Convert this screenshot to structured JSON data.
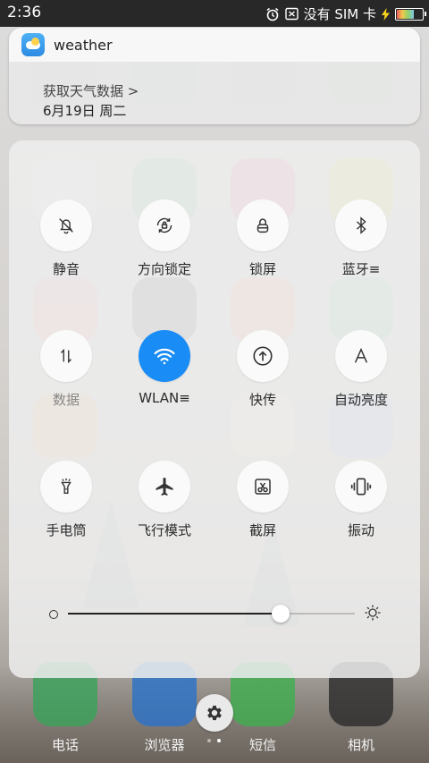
{
  "status_bar": {
    "time": "2:36",
    "carrier": "没有 SIM 卡",
    "battery_level": 0.7,
    "icons": [
      "alarm-icon",
      "sim-error-icon",
      "charging-icon",
      "battery-icon"
    ]
  },
  "notification": {
    "app_name": "weather",
    "line1": "获取天气数据 >",
    "line2": "6月19日 周二"
  },
  "quick_settings": {
    "tiles": [
      {
        "label": "静音",
        "icon": "silent-bell-icon",
        "active": false,
        "dim": false
      },
      {
        "label": "方向锁定",
        "icon": "rotation-lock-icon",
        "active": false,
        "dim": false
      },
      {
        "label": "锁屏",
        "icon": "lock-icon",
        "active": false,
        "dim": false
      },
      {
        "label": "蓝牙≡",
        "icon": "bluetooth-icon",
        "active": false,
        "dim": false
      },
      {
        "label": "数据",
        "icon": "mobile-data-icon",
        "active": false,
        "dim": true
      },
      {
        "label": "WLAN≡",
        "icon": "wifi-icon",
        "active": true,
        "dim": false
      },
      {
        "label": "快传",
        "icon": "quick-transfer-icon",
        "active": false,
        "dim": false
      },
      {
        "label": "自动亮度",
        "icon": "auto-brightness-icon",
        "active": false,
        "dim": false
      },
      {
        "label": "手电筒",
        "icon": "flashlight-icon",
        "active": false,
        "dim": false
      },
      {
        "label": "飞行模式",
        "icon": "airplane-icon",
        "active": false,
        "dim": false
      },
      {
        "label": "截屏",
        "icon": "screenshot-icon",
        "active": false,
        "dim": false
      },
      {
        "label": "振动",
        "icon": "vibrate-icon",
        "active": false,
        "dim": false
      }
    ],
    "active_color": "#1a8cf5"
  },
  "brightness": {
    "value": 0.74,
    "low_icon": "brightness-low-icon",
    "high_icon": "brightness-high-icon"
  },
  "bottom": {
    "settings_icon": "gear-icon",
    "page_indicator": {
      "count": 2,
      "current": 1
    }
  },
  "dock": {
    "labels": [
      "电话",
      "浏览器",
      "短信",
      "相机"
    ]
  }
}
